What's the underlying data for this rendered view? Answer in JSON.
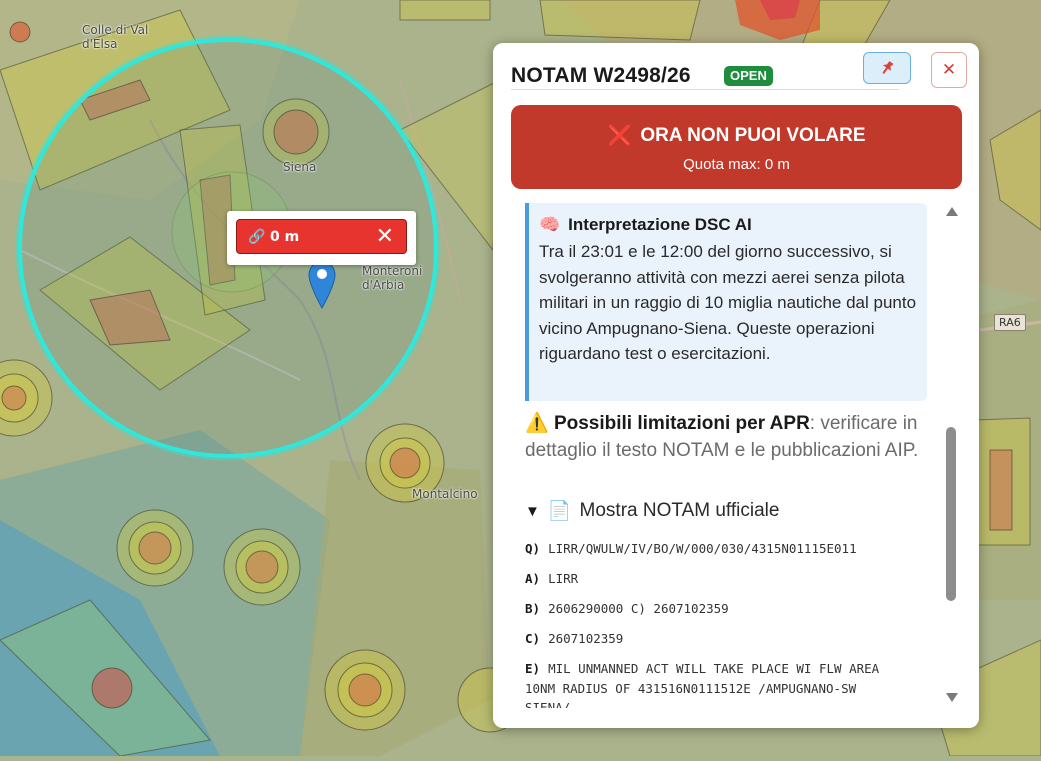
{
  "map": {
    "labels": {
      "colle": "Colle di Val\nd'Elsa",
      "siena": "Siena",
      "monteroni": "Monteroni\nd'Arbia",
      "montalcino": "Montalcino",
      "road": "RA6"
    },
    "colors": {
      "radius_circle": "#2ee8dc",
      "zone_yellow": "#d8cf3a",
      "zone_red": "#d9484a",
      "zone_blue": "#3a9bd8",
      "zone_green": "#9bd26a",
      "marker": "#2f86d8"
    },
    "icons": [
      "pin-marker-icon",
      "link-icon",
      "close-icon"
    ]
  },
  "marker_popup": {
    "altitude": "0 m"
  },
  "panel": {
    "title": "NOTAM W2498/26",
    "status": "OPEN",
    "alert": {
      "title": "ORA NON PUOI VOLARE",
      "subtitle": "Quota max: 0 m"
    },
    "ai": {
      "title": "Interpretazione DSC AI",
      "text": "Tra il 23:01 e le 12:00 del giorno successivo, si svolgeranno attività con mezzi aerei senza pilota militari in un raggio di 10 miglia nautiche dal punto vicino Ampugnano-Siena. Queste operazioni riguardano test o esercitazioni."
    },
    "limits": {
      "label": "Possibili limitazioni per APR",
      "text": ": verificare in dettaglio il testo NOTAM e le pubblicazioni AIP."
    },
    "toggle_label": "Mostra NOTAM ufficiale",
    "notam": [
      {
        "k": "Q)",
        "v": "LIRR/QWULW/IV/BO/W/000/030/4315N01115E011"
      },
      {
        "k": "A)",
        "v": "LIRR"
      },
      {
        "k": "B)",
        "v": "2606290000 C) 2607102359"
      },
      {
        "k": "C)",
        "v": "2607102359"
      },
      {
        "k": "E)",
        "v": "MIL UNMANNED ACT WILL TAKE PLACE WI FLW AREA",
        "extra": [
          "10NM RADIUS OF 431516N0111512E /AMPUGNANO-SW",
          "SIENA/"
        ]
      }
    ],
    "scroll_position": 0.55
  }
}
